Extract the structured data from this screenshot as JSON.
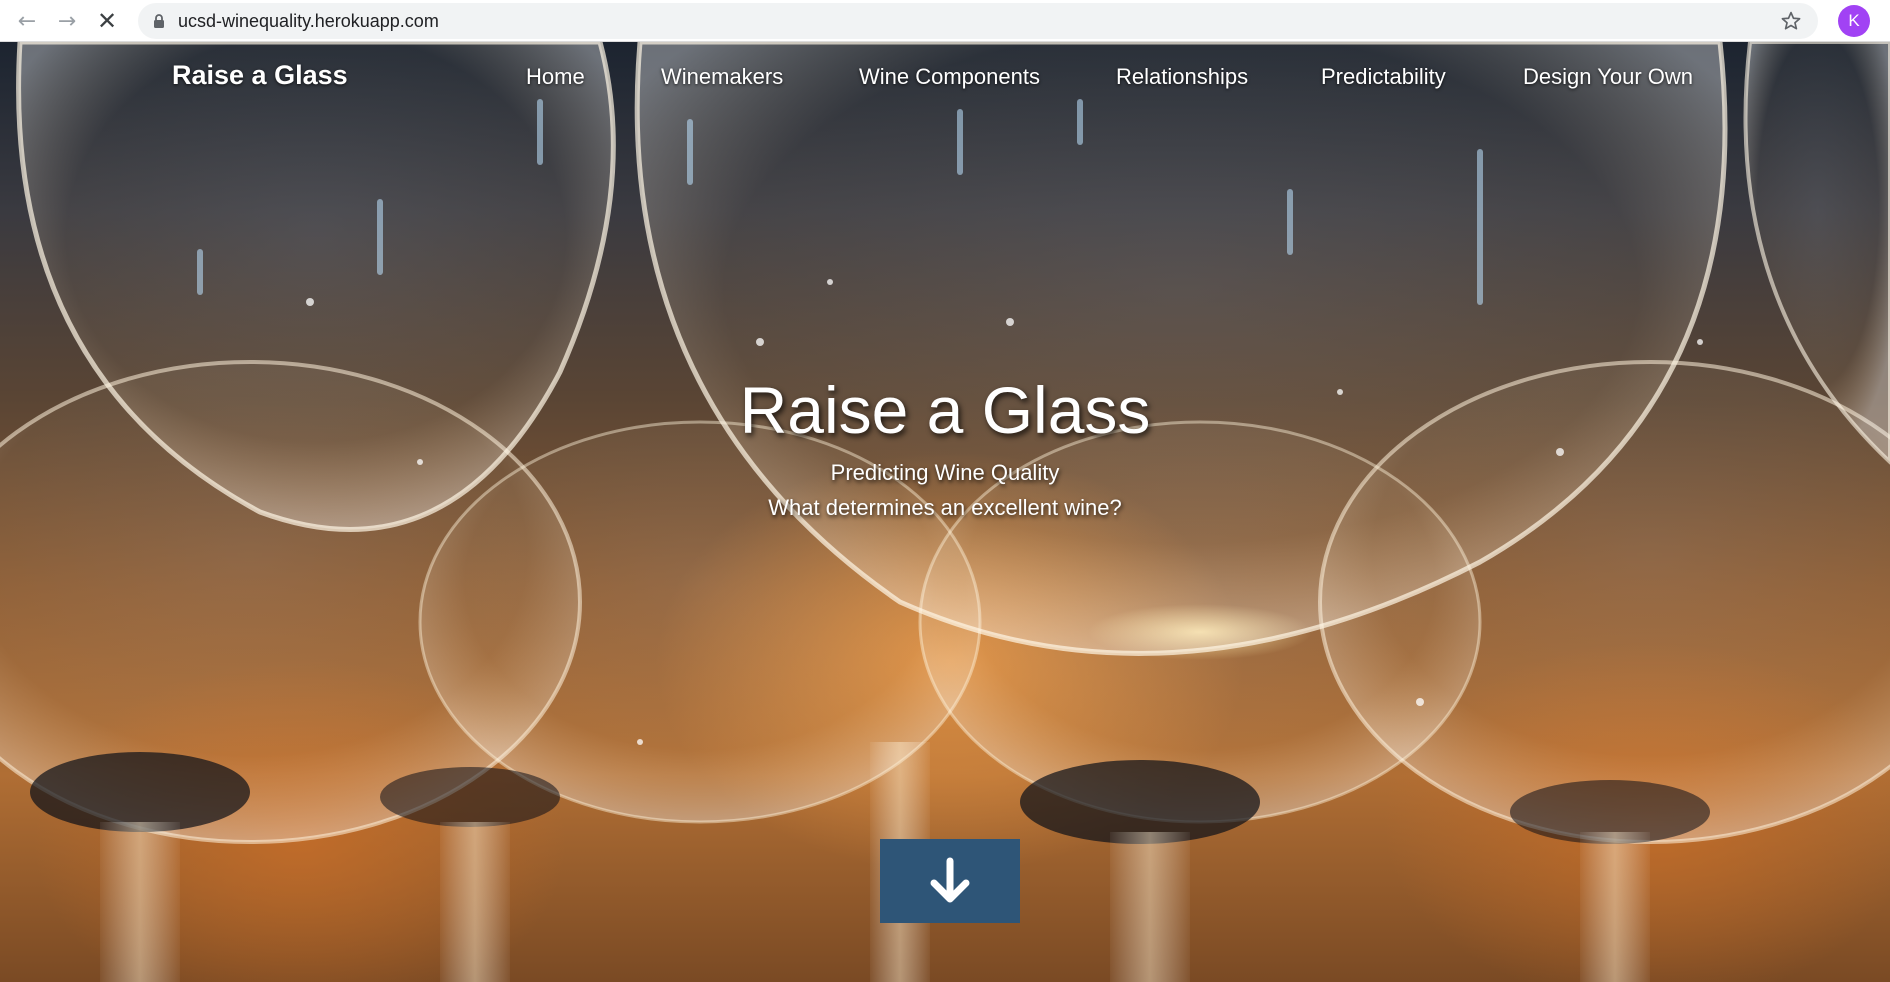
{
  "browser": {
    "url": "ucsd-winequality.herokuapp.com",
    "back_icon": "arrow-left-icon",
    "forward_icon": "arrow-right-icon",
    "stop_icon": "close-icon",
    "lock_icon": "lock-icon",
    "star_icon": "star-outline-icon",
    "profile_initial": "K",
    "profile_color": "#a142f4"
  },
  "site": {
    "brand": "Raise a Glass",
    "nav": [
      {
        "label": "Home"
      },
      {
        "label": "Winemakers"
      },
      {
        "label": "Wine Components"
      },
      {
        "label": "Relationships"
      },
      {
        "label": "Predictability"
      },
      {
        "label": "Design Your Own"
      }
    ]
  },
  "hero": {
    "title": "Raise a Glass",
    "subtitle": "Predicting Wine Quality",
    "tagline": "What determines an excellent wine?",
    "scroll_icon": "arrow-down-icon",
    "button_color": "#2e5577"
  }
}
